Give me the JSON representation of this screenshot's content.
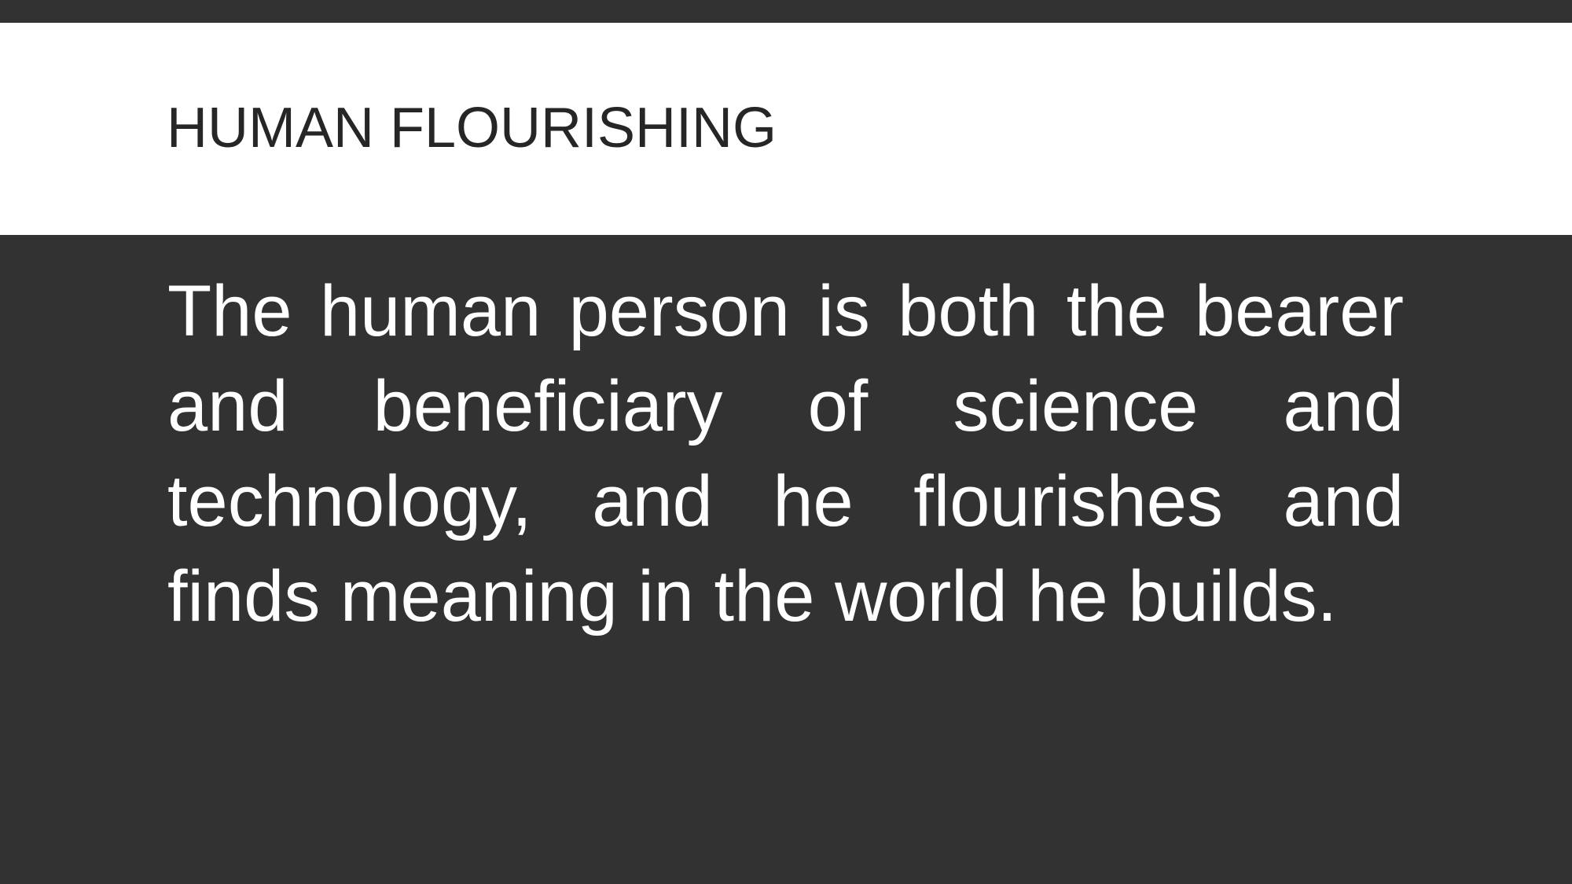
{
  "slide": {
    "title": "HUMAN FLOURISHING",
    "body": "The human person is both the bearer and beneficiary of science and technology, and he flourishes and finds meaning in the world he builds."
  },
  "colors": {
    "background": "#323232",
    "title_band": "#ffffff",
    "title_text": "#262626",
    "body_text": "#ffffff"
  }
}
